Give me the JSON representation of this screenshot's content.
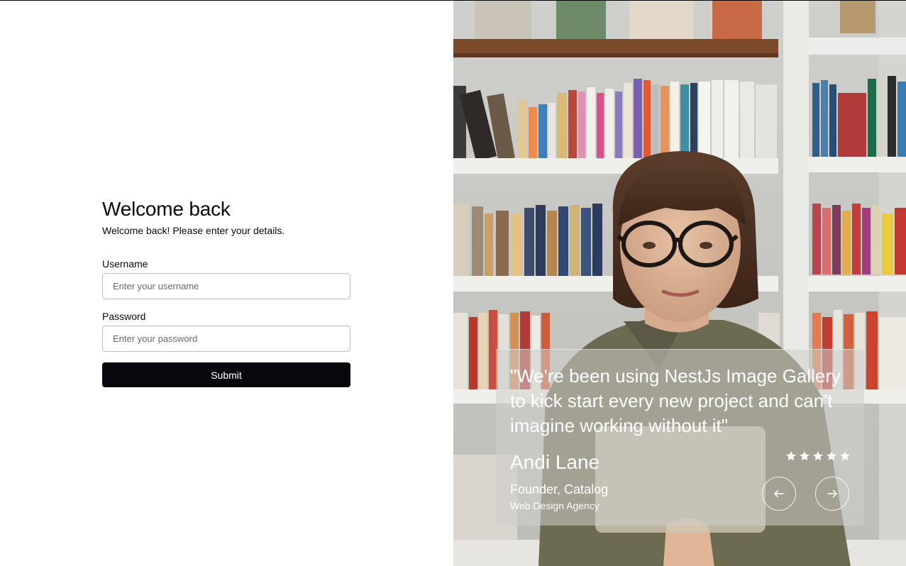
{
  "login": {
    "title": "Welcome back",
    "subtitle": "Welcome back! Please enter your details.",
    "username_label": "Username",
    "username_placeholder": "Enter your username",
    "username_value": "",
    "password_label": "Password",
    "password_placeholder": "Enter your password",
    "password_value": "",
    "submit_label": "Submit"
  },
  "testimonial": {
    "quote": "\"We're been using NestJs Image Gallery to kick start every new project and can't imagine working without it\"",
    "author": "Andi Lane",
    "role": "Founder, Catalog",
    "company": "Web Design Agency",
    "rating": 5,
    "rating_max": 5,
    "star_icon": "star-icon",
    "prev_icon": "arrow-left-icon",
    "next_icon": "arrow-right-icon"
  },
  "photo": {
    "icon": "woman-reading-in-bookshop-photo"
  },
  "colors": {
    "submit_bg": "#07080c",
    "submit_text": "#ffffff",
    "input_border": "#bdbdbd",
    "card_bg": "rgba(205,205,202,0.55)"
  }
}
